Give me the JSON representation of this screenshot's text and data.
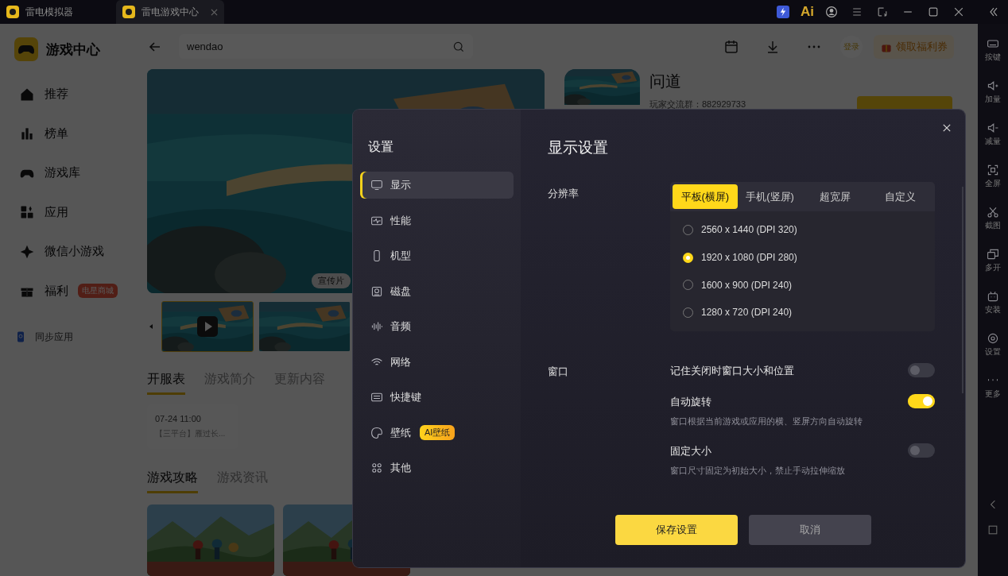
{
  "title_bar": {
    "tabs": [
      {
        "label": "雷电模拟器",
        "selected": false
      },
      {
        "label": "雷电游戏中心",
        "selected": true
      }
    ],
    "ai_label": "Ai"
  },
  "sidebar": {
    "app_name": "游戏中心",
    "items": [
      {
        "label": "推荐"
      },
      {
        "label": "榜单"
      },
      {
        "label": "游戏库"
      },
      {
        "label": "应用"
      },
      {
        "label": "微信小游戏"
      },
      {
        "label": "福利",
        "badge": "电星商城"
      }
    ],
    "sync": "同步应用"
  },
  "header": {
    "search": {
      "value": "wendao"
    },
    "login": "登录",
    "coupon": "领取福利券"
  },
  "game": {
    "title": "问道",
    "group": "玩家交流群：882929733",
    "video_label": "宣传片",
    "tabs": [
      {
        "label": "开服表",
        "selected": true
      },
      {
        "label": "游戏简介",
        "selected": false
      },
      {
        "label": "更新内容",
        "selected": false
      }
    ],
    "schedule": [
      {
        "time": "07-24 11:00",
        "text": "【三平台】雁过长..."
      }
    ],
    "article_tabs": [
      {
        "label": "游戏攻略",
        "selected": true
      },
      {
        "label": "游戏资讯",
        "selected": false
      }
    ]
  },
  "side_toolbar": [
    "按键",
    "加量",
    "减量",
    "全屏",
    "截图",
    "多开",
    "安装",
    "设置",
    "更多"
  ],
  "settings": {
    "title": "设置",
    "nav": [
      {
        "label": "显示",
        "selected": true
      },
      {
        "label": "性能",
        "selected": false
      },
      {
        "label": "机型",
        "selected": false
      },
      {
        "label": "磁盘",
        "selected": false
      },
      {
        "label": "音频",
        "selected": false
      },
      {
        "label": "网络",
        "selected": false
      },
      {
        "label": "快捷键",
        "selected": false
      },
      {
        "label": "壁纸",
        "selected": false,
        "badge": "AI壁纸"
      },
      {
        "label": "其他",
        "selected": false
      }
    ],
    "heading": "显示设置",
    "resolution_label": "分辨率",
    "modes": [
      {
        "label": "平板(横屏)",
        "selected": true
      },
      {
        "label": "手机(竖屏)",
        "selected": false
      },
      {
        "label": "超宽屏",
        "selected": false
      },
      {
        "label": "自定义",
        "selected": false
      }
    ],
    "resolutions": [
      {
        "label": "2560 x 1440  (DPI 320)",
        "selected": false
      },
      {
        "label": "1920 x 1080  (DPI 280)",
        "selected": true
      },
      {
        "label": "1600 x 900  (DPI 240)",
        "selected": false
      },
      {
        "label": "1280 x 720  (DPI 240)",
        "selected": false
      }
    ],
    "window_label": "窗口",
    "window_options": [
      {
        "label": "记住关闭时窗口大小和位置",
        "on": false
      },
      {
        "label": "自动旋转",
        "on": true,
        "description": "窗口根据当前游戏或应用的横、竖屏方向自动旋转"
      },
      {
        "label": "固定大小",
        "on": false,
        "description": "窗口尺寸固定为初始大小，禁止手动拉伸缩放"
      }
    ],
    "save": "保存设置",
    "cancel": "取消"
  }
}
